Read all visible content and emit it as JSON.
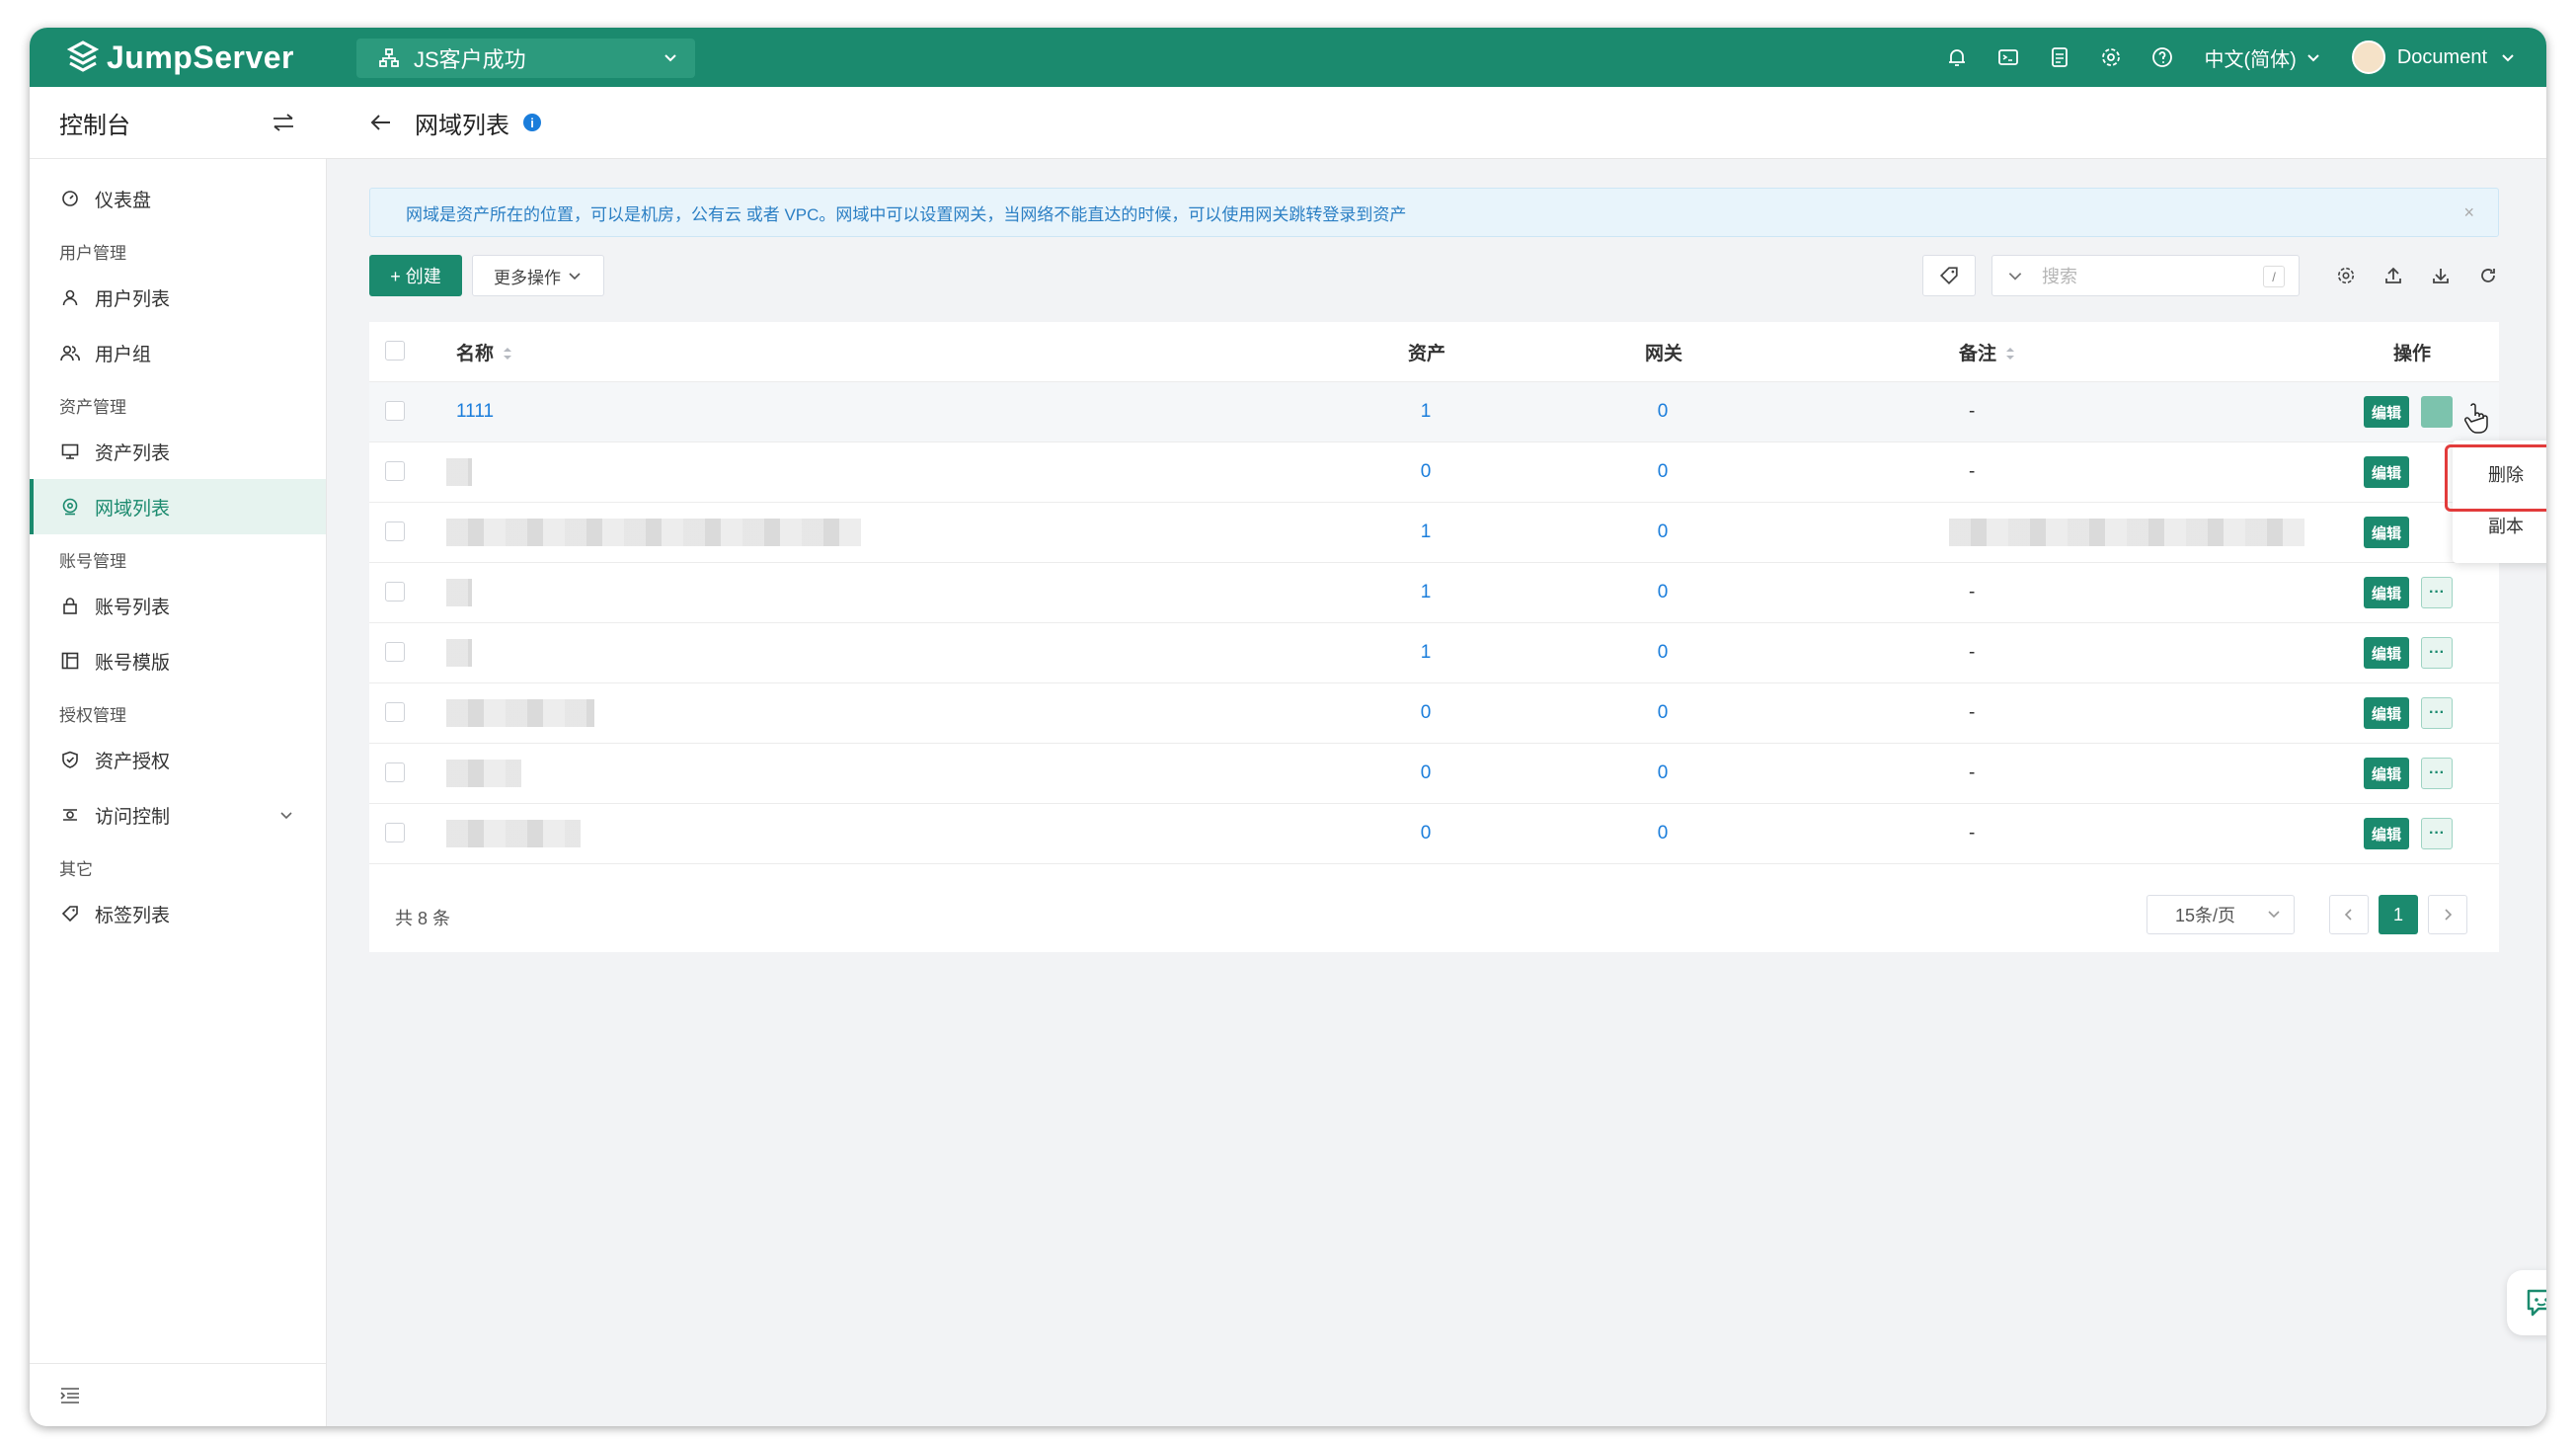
{
  "app": {
    "name": "JumpServer"
  },
  "topbar": {
    "org_name": "JS客户成功",
    "language": "中文(简体)",
    "user_name": "Document",
    "icons": [
      "bell-icon",
      "terminal-icon",
      "tickets-icon",
      "settings-icon",
      "help-icon"
    ]
  },
  "sidebar": {
    "title": "控制台",
    "dashboard": "仪表盘",
    "groups": {
      "user_mgmt": "用户管理",
      "asset_mgmt": "资产管理",
      "account_mgmt": "账号管理",
      "perm_mgmt": "授权管理",
      "other": "其它"
    },
    "items": {
      "user_list": "用户列表",
      "user_group": "用户组",
      "asset_list": "资产列表",
      "zone_list": "网域列表",
      "account_list": "账号列表",
      "account_template": "账号模版",
      "asset_perm": "资产授权",
      "access_control": "访问控制",
      "tag_list": "标签列表"
    },
    "active_item": "网域列表"
  },
  "page": {
    "title": "网域列表",
    "info_mark": "i",
    "alert": "网域是资产所在的位置，可以是机房，公有云 或者 VPC。网域中可以设置网关，当网络不能直达的时候，可以使用网关跳转登录到资产",
    "alert_close": "×"
  },
  "toolbar": {
    "create_label": "+ 创建",
    "more_label": "更多操作",
    "search_placeholder": "搜索",
    "search_shortcut": "/"
  },
  "table": {
    "columns": {
      "name": "名称",
      "assets": "资产",
      "gateways": "网关",
      "comment": "备注",
      "actions": "操作"
    },
    "edit_label": "编辑",
    "more_label": "···",
    "rows": [
      {
        "name": "1111",
        "assets": "1",
        "gateways": "0",
        "comment": "-"
      },
      {
        "name": "",
        "assets": "0",
        "gateways": "0",
        "comment": "-"
      },
      {
        "name": "",
        "assets": "1",
        "gateways": "0",
        "comment": ""
      },
      {
        "name": "",
        "assets": "1",
        "gateways": "0",
        "comment": "-"
      },
      {
        "name": "",
        "assets": "1",
        "gateways": "0",
        "comment": "-"
      },
      {
        "name": "",
        "assets": "0",
        "gateways": "0",
        "comment": "-"
      },
      {
        "name": "",
        "assets": "0",
        "gateways": "0",
        "comment": "-"
      },
      {
        "name": "",
        "assets": "0",
        "gateways": "0",
        "comment": "-"
      }
    ]
  },
  "pagination": {
    "total": "共 8 条",
    "page_size": "15条/页",
    "current_page": "1"
  },
  "dropdown": {
    "items": [
      "删除",
      "副本"
    ]
  },
  "colors": {
    "brand": "#1b8a6e",
    "link": "#1a7ddb",
    "highlight_box": "#e23b3b"
  }
}
